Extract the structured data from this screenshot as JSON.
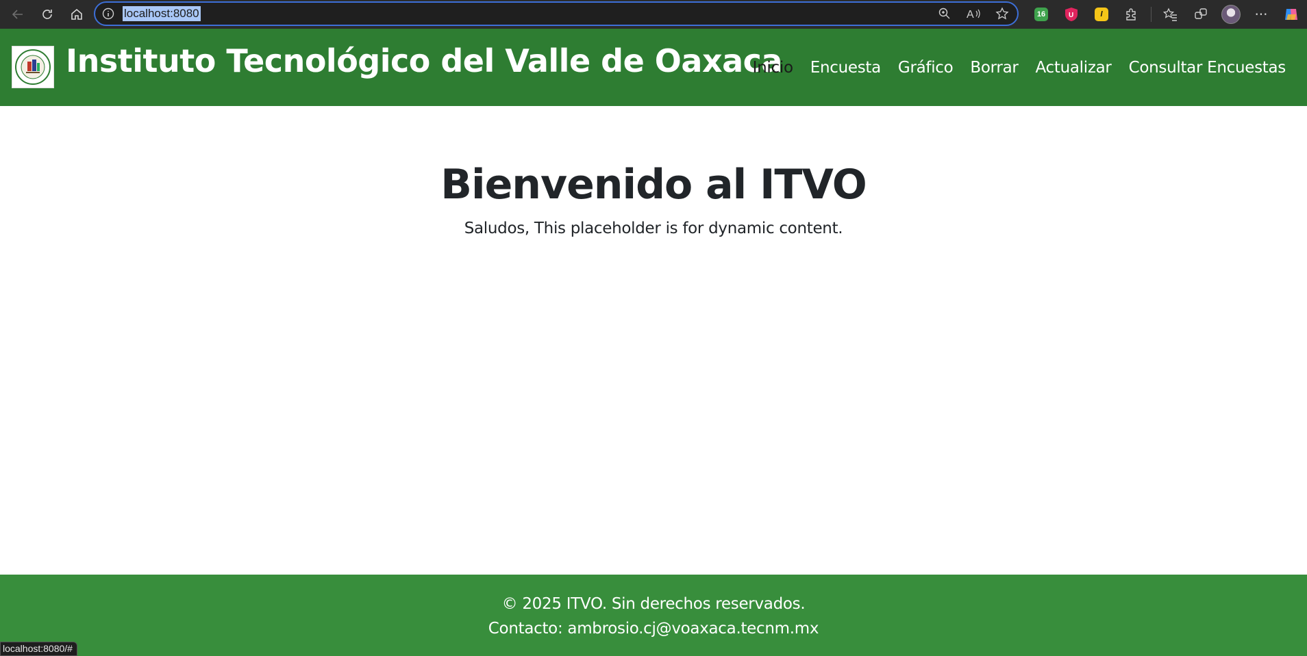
{
  "browser": {
    "url": "localhost:8080",
    "status_url": "localhost:8080/#",
    "extensions": [
      {
        "name": "tampermonkey-icon",
        "label": "16",
        "color": "#3fa34d"
      },
      {
        "name": "ublock-icon",
        "label": "U",
        "color": "#e0245e"
      },
      {
        "name": "extension-l-icon",
        "label": "l",
        "color": "#f5c518"
      }
    ]
  },
  "navbar": {
    "brand": "Instituto Tecnológico del Valle de Oaxaca",
    "links": [
      "Inicio",
      "Encuesta",
      "Gráfico",
      "Borrar",
      "Actualizar",
      "Consultar Encuestas"
    ],
    "active_link": "Inicio"
  },
  "main": {
    "title": "Bienvenido al ITVO",
    "subtitle": "Saludos, This placeholder is for dynamic content."
  },
  "footer": {
    "copyright": "© 2025 ITVO. Sin derechos reservados.",
    "contact": "Contacto: ambrosio.cj@voaxaca.tecnm.mx"
  },
  "colors": {
    "navbar_bg": "#2e7d32",
    "footer_bg": "#388e3c",
    "heading_text": "#212529",
    "active_link": "#1a1a1a"
  }
}
